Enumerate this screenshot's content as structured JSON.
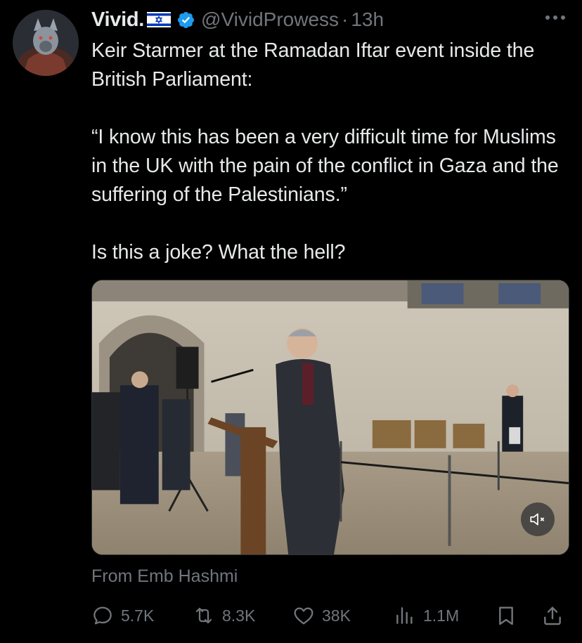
{
  "author": {
    "display_name": "Vivid.",
    "flag_icon": "israel-flag-icon",
    "verified_icon": "verified-badge-icon",
    "verified_color": "#1d9bf0",
    "handle": "@VividProwess",
    "separator": "·",
    "time": "13h"
  },
  "tweet": {
    "lines": [
      "Keir Starmer at the Ramadan Iftar event inside the British Parliament:",
      "“I know this has been a very difficult time for Muslims in the UK with the pain of the conflict in Gaza and the suffering of the Palestinians.”",
      "Is this a joke? What the hell?"
    ]
  },
  "media": {
    "type": "video",
    "mute_icon": "speaker-muted-icon",
    "attribution": "From Emb Hashmi"
  },
  "actions": {
    "replies": "5.7K",
    "reposts": "8.3K",
    "likes": "38K",
    "views": "1.1M"
  },
  "colors": {
    "background": "#000000",
    "text": "#e7e9ea",
    "muted": "#71767b",
    "accent": "#1d9bf0"
  }
}
